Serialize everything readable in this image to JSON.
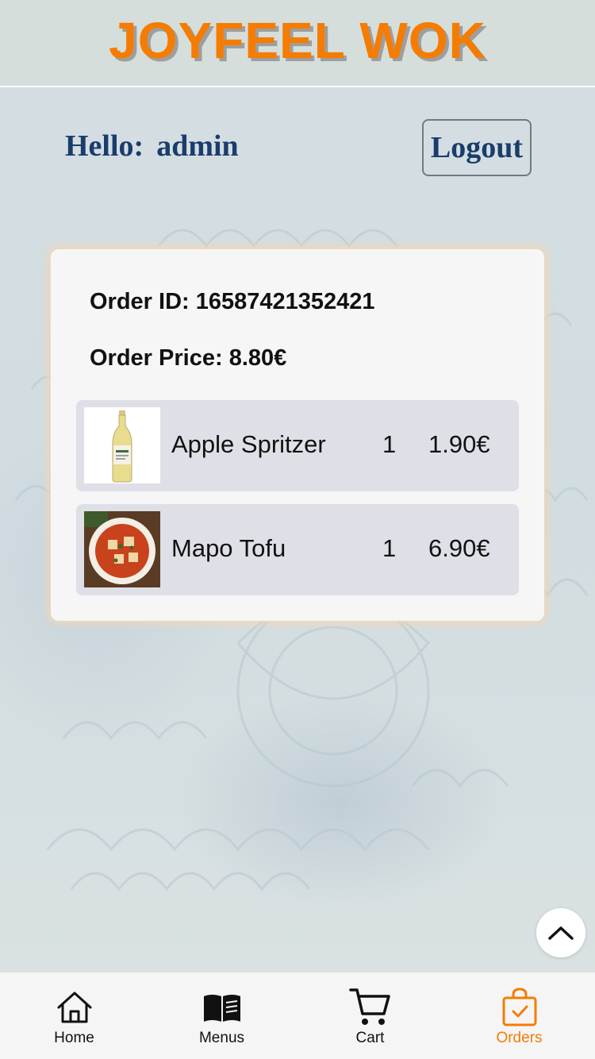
{
  "header": {
    "brand": "JOYFEEL WOK"
  },
  "greeting": {
    "hello": "Hello:",
    "username": "admin"
  },
  "logout_label": "Logout",
  "order": {
    "id_label": "Order ID:",
    "id": "16587421352421",
    "price_label": "Order Price:",
    "price": "8.80€",
    "items": [
      {
        "name": "Apple Spritzer",
        "qty": "1",
        "price": "1.90€",
        "image": "apple-spritzer-bottle"
      },
      {
        "name": "Mapo Tofu",
        "qty": "1",
        "price": "6.90€",
        "image": "mapo-tofu-bowl"
      }
    ]
  },
  "nav": {
    "tabs": [
      {
        "label": "Home",
        "icon": "home-icon",
        "active": false
      },
      {
        "label": "Menus",
        "icon": "book-icon",
        "active": false
      },
      {
        "label": "Cart",
        "icon": "cart-icon",
        "active": false
      },
      {
        "label": "Orders",
        "icon": "shopping-bag-check-icon",
        "active": true
      }
    ]
  },
  "colors": {
    "brand": "#f57c00",
    "text_dark_blue": "#1a3d6b",
    "active_tab": "#f57c00"
  }
}
